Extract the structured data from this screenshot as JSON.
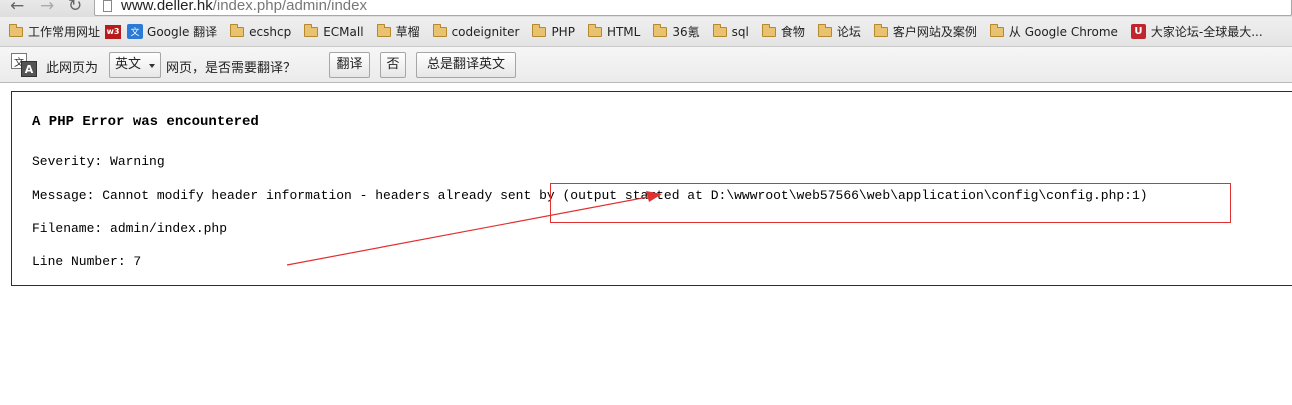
{
  "browser": {
    "url_domain": "www.deller.hk",
    "url_path": "/index.php/admin/index"
  },
  "bookmarks": [
    {
      "label": "工作常用网址",
      "icon": "folder-icon"
    },
    {
      "label": "Google 翻译",
      "icon": "translate-icon"
    },
    {
      "label": "ecshcp",
      "icon": "folder-icon"
    },
    {
      "label": "ECMall",
      "icon": "folder-icon"
    },
    {
      "label": "草榴",
      "icon": "folder-icon"
    },
    {
      "label": "codeigniter",
      "icon": "folder-icon"
    },
    {
      "label": "PHP",
      "icon": "folder-icon"
    },
    {
      "label": "HTML",
      "icon": "folder-icon"
    },
    {
      "label": "36氪",
      "icon": "folder-icon"
    },
    {
      "label": "sql",
      "icon": "folder-icon"
    },
    {
      "label": "食物",
      "icon": "folder-icon"
    },
    {
      "label": "论坛",
      "icon": "folder-icon"
    },
    {
      "label": "客户网站及案例",
      "icon": "folder-icon"
    },
    {
      "label": "从 Google Chrome",
      "icon": "folder-icon"
    },
    {
      "label": "大家论坛-全球最大...",
      "icon": "bookmark-pin-icon"
    }
  ],
  "bookmark_badge": "w3",
  "translate_bar": {
    "prefix": "此网页为",
    "language": "英文",
    "question": "网页，是否需要翻译？",
    "translate_button": "翻译",
    "no_button": "否",
    "always_button": "总是翻译英文"
  },
  "error": {
    "title": "A PHP Error was encountered",
    "severity": "Severity: Warning",
    "message": "Message: Cannot modify header information - headers already sent by (output started at D:\\wwwroot\\web57566\\web\\application\\config\\config.php:1)",
    "filename": "Filename: admin/index.php",
    "line_number": "Line Number: 7"
  },
  "colors": {
    "error_border": "#990000",
    "annotation": "#e03030"
  }
}
